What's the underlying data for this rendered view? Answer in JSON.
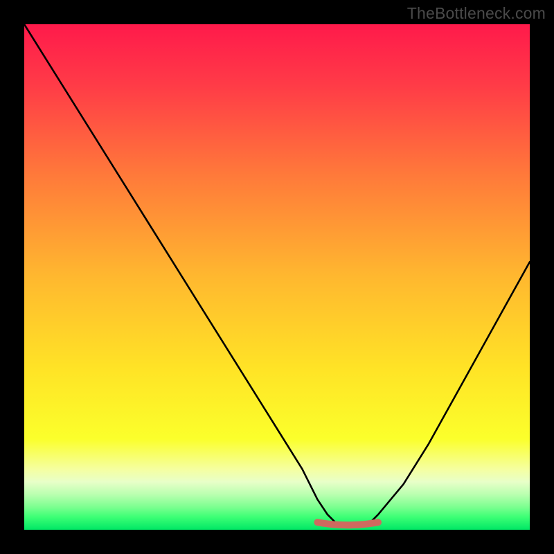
{
  "watermark": "TheBottleneck.com",
  "colors": {
    "frame": "#000000",
    "curve": "#000000",
    "marker": "#cf6a5f",
    "gradient_stops": [
      {
        "offset": 0.0,
        "color": "#ff1a4b"
      },
      {
        "offset": 0.12,
        "color": "#ff3b47"
      },
      {
        "offset": 0.3,
        "color": "#ff7a3a"
      },
      {
        "offset": 0.5,
        "color": "#ffb82f"
      },
      {
        "offset": 0.68,
        "color": "#ffe326"
      },
      {
        "offset": 0.82,
        "color": "#fbff2b"
      },
      {
        "offset": 0.88,
        "color": "#f5ffa0"
      },
      {
        "offset": 0.905,
        "color": "#e8ffc8"
      },
      {
        "offset": 0.93,
        "color": "#baffb0"
      },
      {
        "offset": 0.955,
        "color": "#7cff90"
      },
      {
        "offset": 0.975,
        "color": "#3cff75"
      },
      {
        "offset": 1.0,
        "color": "#00e765"
      }
    ]
  },
  "chart_data": {
    "type": "line",
    "title": "",
    "xlabel": "",
    "ylabel": "",
    "xlim": [
      0,
      100
    ],
    "ylim": [
      0,
      100
    ],
    "grid": false,
    "series": [
      {
        "name": "bottleneck-curve",
        "x": [
          0,
          5,
          10,
          15,
          20,
          25,
          30,
          35,
          40,
          45,
          50,
          55,
          58,
          60,
          62,
          64,
          66,
          68,
          70,
          75,
          80,
          85,
          90,
          95,
          100
        ],
        "y": [
          100,
          92,
          84,
          76,
          68,
          60,
          52,
          44,
          36,
          28,
          20,
          12,
          6,
          3,
          1,
          1,
          1,
          1,
          3,
          9,
          17,
          26,
          35,
          44,
          53
        ]
      }
    ],
    "annotations": [
      {
        "name": "optimal-range-marker",
        "x_start": 58,
        "x_end": 70,
        "y": 1.2,
        "color": "#cf6a5f"
      }
    ]
  }
}
